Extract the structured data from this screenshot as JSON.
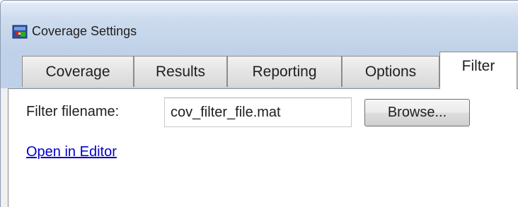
{
  "window": {
    "title": "Coverage Settings",
    "icon": "coverage-settings-app-icon"
  },
  "tabs": [
    {
      "label": "Coverage",
      "selected": false
    },
    {
      "label": "Results",
      "selected": false
    },
    {
      "label": "Reporting",
      "selected": false
    },
    {
      "label": "Options",
      "selected": false
    },
    {
      "label": "Filter",
      "selected": true
    }
  ],
  "filter": {
    "filename_label": "Filter filename:",
    "filename_value": "cov_filter_file.mat",
    "browse_label": "Browse...",
    "open_editor_link": "Open in Editor"
  },
  "colors": {
    "titlebar": "#bfd1e8",
    "link": "#0000cc",
    "panel": "#ffffff"
  }
}
